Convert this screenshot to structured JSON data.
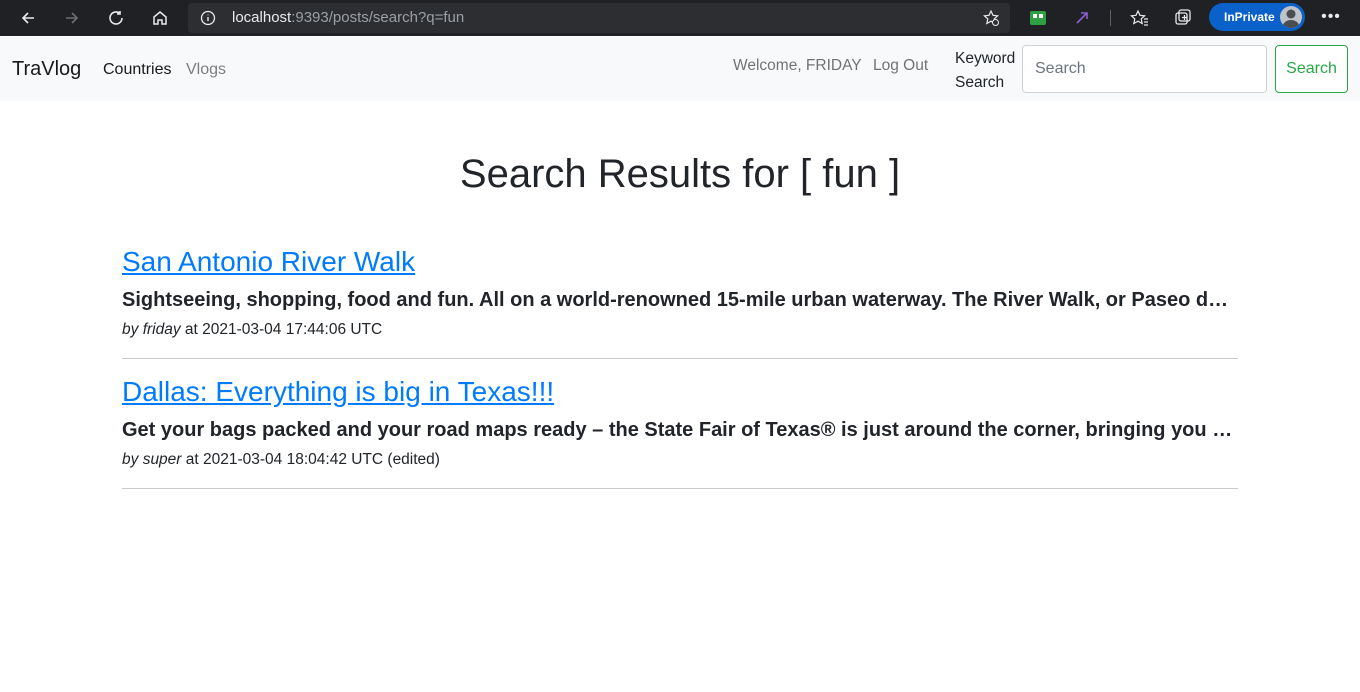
{
  "browser": {
    "url_host": "localhost",
    "url_rest": ":9393/posts/search?q=fun",
    "inprivate_label": "InPrivate",
    "icons": [
      "back-arrow-icon",
      "forward-arrow-icon",
      "refresh-icon",
      "home-icon",
      "info-icon",
      "add-favorite-icon",
      "extension-icon",
      "favorites-icon",
      "collections-icon",
      "more-icon"
    ]
  },
  "navbar": {
    "brand": "TraVlog",
    "countries": "Countries",
    "vlogs": "Vlogs",
    "welcome": "Welcome, FRIDAY",
    "logout": "Log Out",
    "keyword_label": "Keyword Search",
    "search_placeholder": "Search",
    "search_button": "Search"
  },
  "main": {
    "heading": "Search Results for [ fun ]",
    "results": [
      {
        "title": "San Antonio River Walk",
        "excerpt": "Sightseeing, shopping, food and fun. All on a world-renowned 15-mile urban waterway. The River Walk, or Paseo del Rio, ...",
        "by": "by",
        "author": "friday",
        "timestamp": " at 2021-03-04 17:44:06 UTC"
      },
      {
        "title": "Dallas: Everything is big in Texas!!!",
        "excerpt": "Get your bags packed and your road maps ready – the State Fair of Texas® is just around the corner, bringing you an all-...",
        "by": "by",
        "author": "super",
        "timestamp": " at 2021-03-04 18:04:42 UTC (edited)"
      }
    ]
  },
  "colors": {
    "link": "#007bff",
    "success": "#28a745",
    "navbar_bg": "#f8f9fa",
    "chrome_bg": "#202124",
    "inprivate": "#0a61c9"
  }
}
